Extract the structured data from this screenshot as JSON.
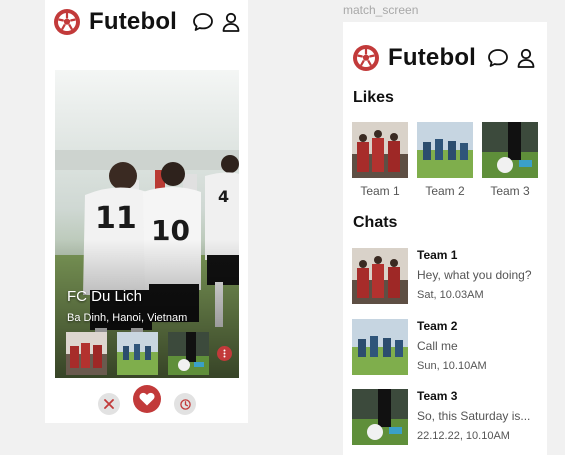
{
  "app": {
    "brand": "Futebol",
    "colors": {
      "accent": "#c23a3a",
      "text": "#111111",
      "muted": "#555555",
      "page_bg": "#f1f1f1"
    },
    "icons": [
      "soccer-ball-logo-icon",
      "chat-bubble-icon",
      "user-profile-icon",
      "info-icon",
      "close-icon",
      "heart-icon",
      "clock-icon"
    ]
  },
  "swipe_screen": {
    "card": {
      "title": "FC Du Lich",
      "subtitle": "Ba Dinh, Hanoi, Vietnam"
    }
  },
  "match_screen": {
    "label": "match_screen",
    "likes_title": "Likes",
    "likes": [
      {
        "label": "Team 1"
      },
      {
        "label": "Team 2"
      },
      {
        "label": "Team 3"
      }
    ],
    "chats_title": "Chats",
    "chats": [
      {
        "name": "Team 1",
        "message": "Hey, what you doing?",
        "time": "Sat, 10.03AM"
      },
      {
        "name": "Team 2",
        "message": "Call me",
        "time": "Sun, 10.10AM"
      },
      {
        "name": "Team 3",
        "message": "So, this Saturday is...",
        "time": "22.12.22, 10.10AM"
      }
    ]
  }
}
